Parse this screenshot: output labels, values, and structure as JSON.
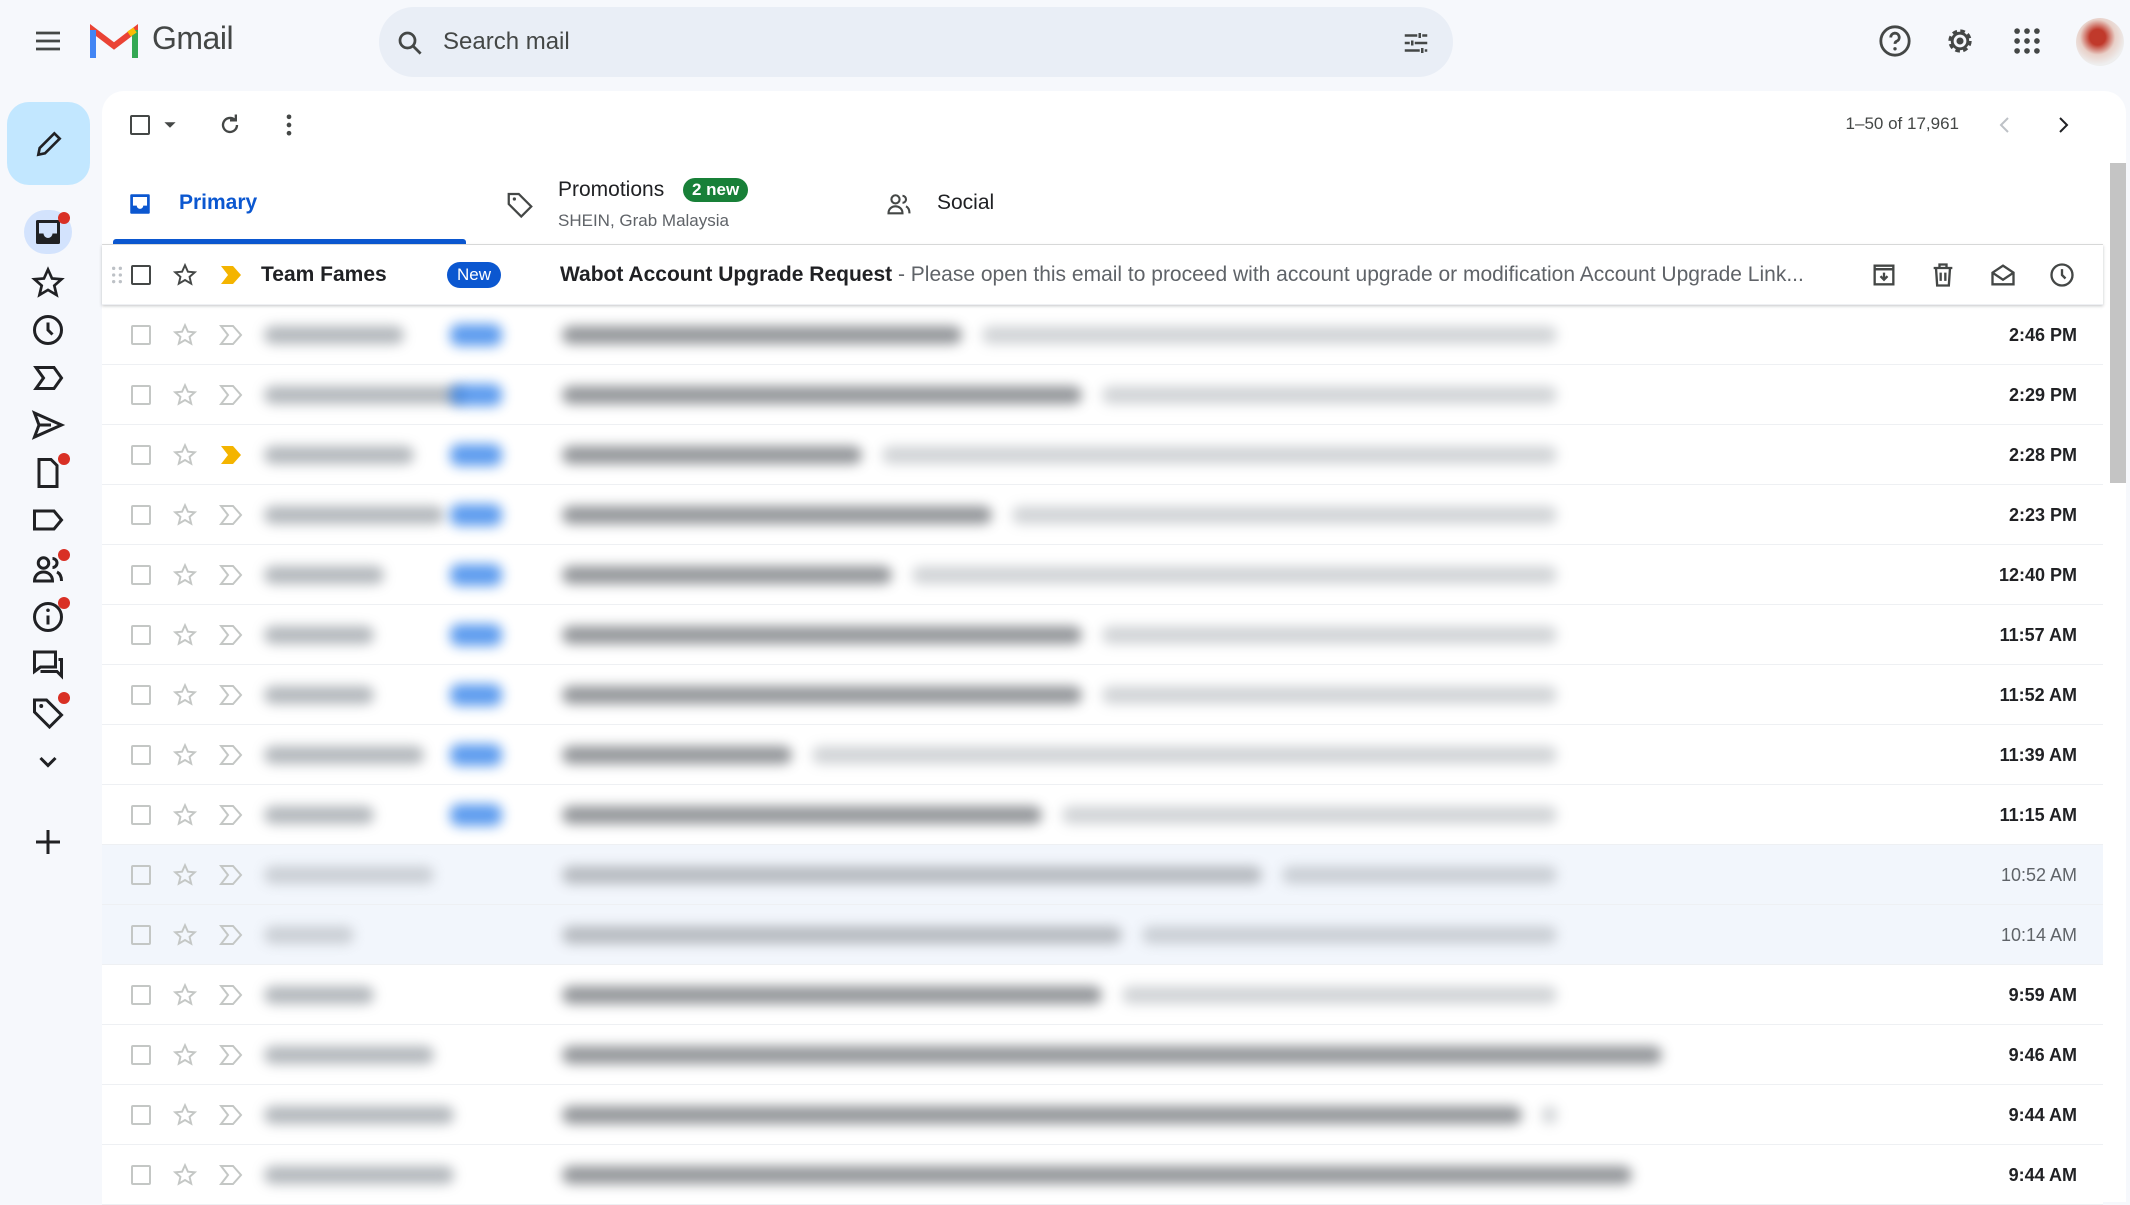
{
  "header": {
    "app_name": "Gmail",
    "search_placeholder": "Search mail"
  },
  "toolbar": {
    "pager": "1–50 of 17,961"
  },
  "tabs": [
    {
      "label": "Primary",
      "active": true
    },
    {
      "label": "Promotions",
      "badge": "2 new",
      "subtitle": "SHEIN, Grab Malaysia"
    },
    {
      "label": "Social"
    }
  ],
  "colors": {
    "accent": "#0b57d0",
    "compose_bg": "#c2e7ff",
    "new_badge": "#188038",
    "important": "#f4b400"
  },
  "first_email": {
    "sender": "Team Fames",
    "badge": "New",
    "subject": "Wabot Account Upgrade Request",
    "snippet": " - Please open this email to proceed with account upgrade or modification Account Upgrade Link..."
  },
  "rows": [
    {
      "time": "2:46 PM",
      "unread": true,
      "labeled": true,
      "important": false
    },
    {
      "time": "2:29 PM",
      "unread": true,
      "labeled": true,
      "important": false
    },
    {
      "time": "2:28 PM",
      "unread": true,
      "labeled": true,
      "important": true
    },
    {
      "time": "2:23 PM",
      "unread": true,
      "labeled": true,
      "important": false
    },
    {
      "time": "12:40 PM",
      "unread": true,
      "labeled": true,
      "important": false
    },
    {
      "time": "11:57 AM",
      "unread": true,
      "labeled": true,
      "important": false
    },
    {
      "time": "11:52 AM",
      "unread": true,
      "labeled": true,
      "important": false
    },
    {
      "time": "11:39 AM",
      "unread": true,
      "labeled": true,
      "important": false
    },
    {
      "time": "11:15 AM",
      "unread": true,
      "labeled": true,
      "important": false
    },
    {
      "time": "10:52 AM",
      "unread": false,
      "labeled": false,
      "important": false
    },
    {
      "time": "10:14 AM",
      "unread": false,
      "labeled": false,
      "important": false
    },
    {
      "time": "9:59 AM",
      "unread": true,
      "labeled": false,
      "important": false
    },
    {
      "time": "9:46 AM",
      "unread": true,
      "labeled": false,
      "important": false
    },
    {
      "time": "9:44 AM",
      "unread": true,
      "labeled": false,
      "important": false
    },
    {
      "time": "9:44 AM",
      "unread": true,
      "labeled": false,
      "important": false
    }
  ]
}
